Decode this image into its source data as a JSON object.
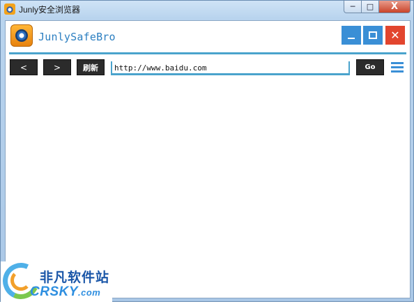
{
  "os_window": {
    "title": "Junly安全浏览器",
    "controls": {
      "minimize": "─",
      "maximize": "□",
      "close": "X"
    }
  },
  "app": {
    "title": "JunlySafeBro"
  },
  "toolbar": {
    "back_label": "<",
    "forward_label": ">",
    "refresh_label": "刷新",
    "url_value": "http://www.baidu.com",
    "go_label": "Go"
  },
  "watermark": {
    "cn": "非凡软件站",
    "en": "CRSKY",
    "en_suffix": ".com"
  },
  "colors": {
    "accent_blue": "#3a8fd6",
    "close_red": "#e2452e",
    "line_blue": "#4aa3cc",
    "button_dark": "#2b2b2b"
  }
}
